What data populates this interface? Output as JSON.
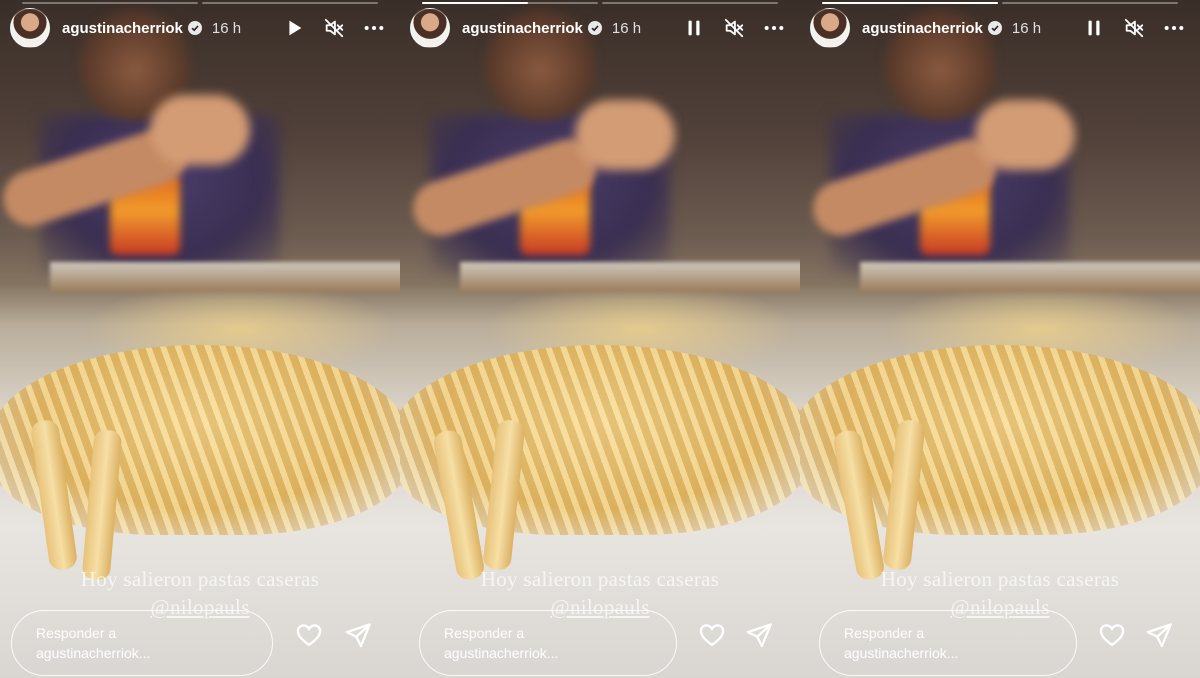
{
  "stories": [
    {
      "username": "agustinacherriok",
      "time": "16 h",
      "playback_icon": "play-icon",
      "mute_icon": "muted-speaker-icon",
      "more_icon": "more-dots-icon",
      "progress": [
        0,
        0
      ],
      "caption_line1": "Hoy salieron pastas caseras",
      "caption_line2": "@nilopauls",
      "reply_line1": "Responder a",
      "reply_line2": "agustinacherriok..."
    },
    {
      "username": "agustinacherriok",
      "time": "16 h",
      "playback_icon": "pause-icon",
      "mute_icon": "muted-speaker-icon",
      "more_icon": "more-dots-icon",
      "progress": [
        0.6,
        0
      ],
      "caption_line1": "Hoy salieron pastas caseras",
      "caption_line2": "@nilopauls",
      "reply_line1": "Responder a",
      "reply_line2": "agustinacherriok..."
    },
    {
      "username": "agustinacherriok",
      "time": "16 h",
      "playback_icon": "pause-icon",
      "mute_icon": "muted-speaker-icon",
      "more_icon": "more-dots-icon",
      "progress": [
        1,
        0
      ],
      "caption_line1": "Hoy salieron pastas caseras",
      "caption_line2": "@nilopauls",
      "reply_line1": "Responder a",
      "reply_line2": "agustinacherriok..."
    }
  ],
  "icons": {
    "like": "heart-icon",
    "share": "send-icon",
    "verified": "verified-badge-icon"
  },
  "colors": {
    "text": "#ffffff",
    "progress_track": "#ffffff59",
    "progress_fill": "#ffffff"
  }
}
